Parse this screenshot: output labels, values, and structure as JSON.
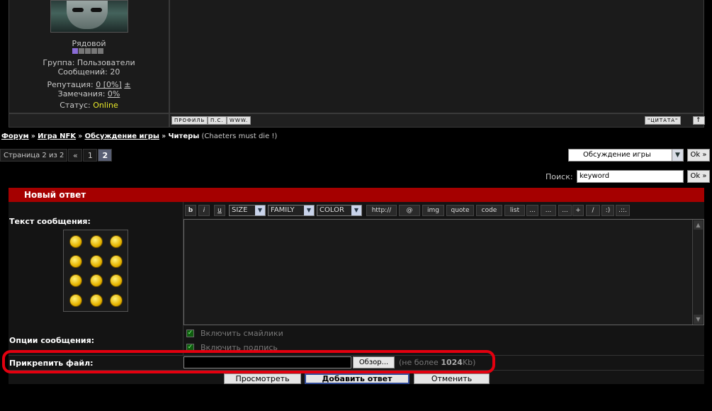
{
  "post": {
    "rank": "Рядовой",
    "group": "Группа: Пользователи",
    "messages": "Сообщений: 20",
    "reputation_label": "Репутация:",
    "reputation_value": "0 [0%]",
    "reputation_pm": "±",
    "warnings_label": "Замечания:",
    "warnings_value": "0%",
    "status_label": "Статус:",
    "status_value": "Online",
    "buttons": {
      "profile": "ПРОФИЛЬ",
      "pm": "П.С.",
      "www": "WWW.",
      "quote": "\"ЦИТАТА\"",
      "top": "↑"
    }
  },
  "breadcrumb": {
    "forum": "Форум",
    "sep": "»",
    "game": "Игра NFK",
    "discussion": "Обсуждение игры",
    "topic": "Читеры",
    "topic_desc": "(Chaeters must die !)"
  },
  "pager": {
    "label": "Страница 2 из 2",
    "prev": "«",
    "page1": "1",
    "page2": "2"
  },
  "jump": {
    "selected": "Обсуждение игры",
    "ok": "Ok »"
  },
  "search": {
    "label": "Поиск:",
    "value": "keyword",
    "ok": "Ok »"
  },
  "reply": {
    "title": "Новый ответ",
    "text_label": "Текст сообщения:",
    "toolbar": {
      "bold": "b",
      "italic": "i",
      "underline": "u",
      "size": "SIZE",
      "family": "FAMILY",
      "color": "COLOR",
      "http": "http://",
      "email": "@",
      "img": "img",
      "quote": "quote",
      "code": "code",
      "list": "list",
      "d1": "...",
      "d2": "...",
      "d3": "...",
      "plus": "+",
      "slash": "/",
      "smile": ":)",
      "more": ".::."
    },
    "options_label": "Опции сообщения:",
    "opt_smilies": "Включить смайлики",
    "opt_signature": "Включить подпись",
    "attach_label": "Прикрепить файл:",
    "browse": "Обзор...",
    "limit_pre": "(не более",
    "limit_num": "1024",
    "limit_post": "Kb)",
    "preview": "Просмотреть",
    "submit": "Добавить ответ",
    "cancel": "Отменить"
  },
  "colors": {
    "header_red": "#a50000",
    "highlight_ring": "#e3000f",
    "online": "#e8e82a"
  },
  "icons": [
    "smiley-icon",
    "scroll-up-icon",
    "scroll-down-icon",
    "checkbox-checked-icon",
    "dropdown-arrow-icon"
  ]
}
